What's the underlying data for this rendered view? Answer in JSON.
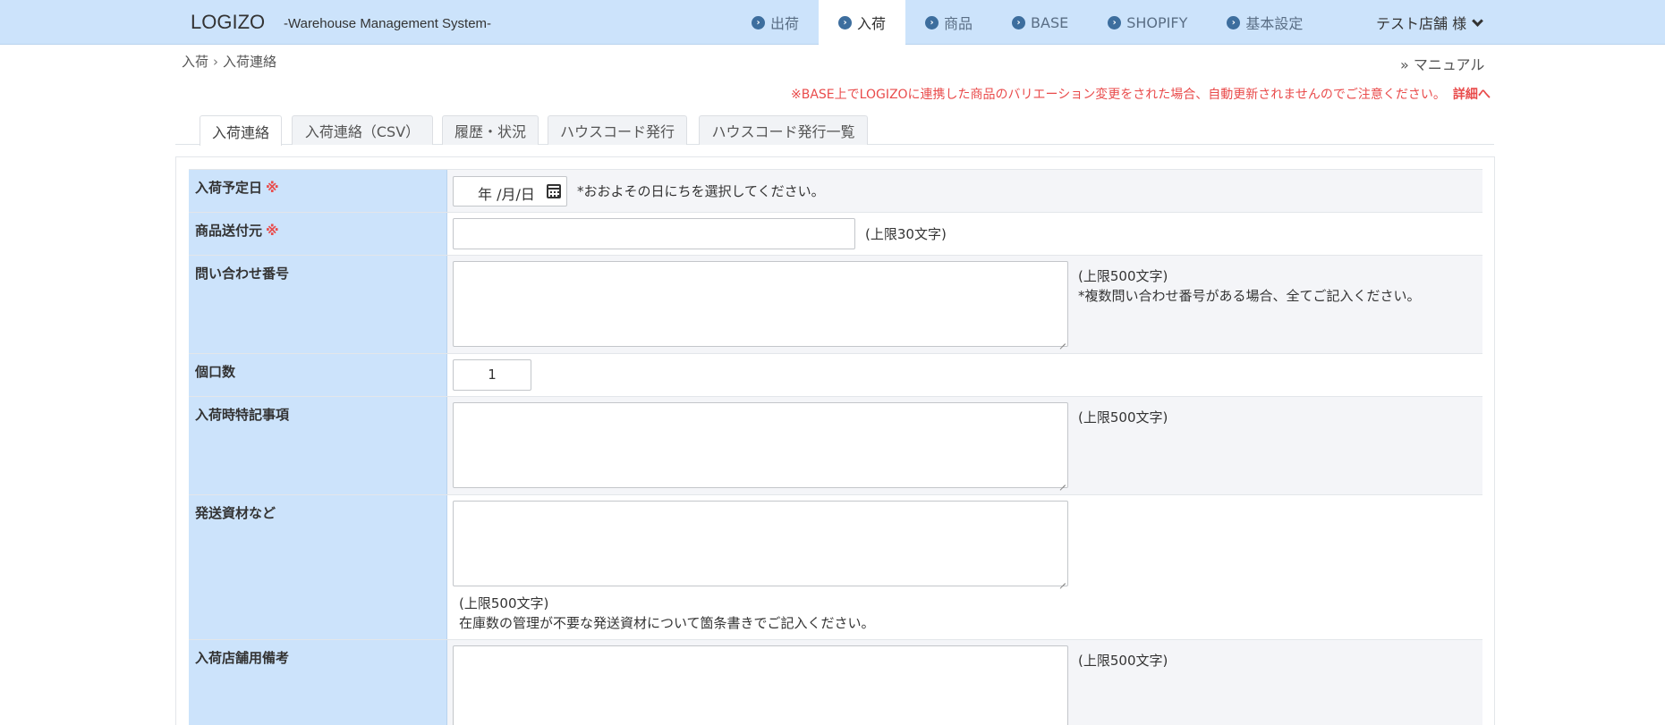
{
  "header": {
    "logo": "LOGIZO",
    "subtitle": "-Warehouse Management System-",
    "nav": [
      {
        "label": "出荷",
        "active": false
      },
      {
        "label": "入荷",
        "active": true
      },
      {
        "label": "商品",
        "active": false
      },
      {
        "label": "BASE",
        "active": false
      },
      {
        "label": "SHOPIFY",
        "active": false
      },
      {
        "label": "基本設定",
        "active": false
      }
    ],
    "user": "テスト店舗 様"
  },
  "breadcrumb": [
    "入荷",
    "入荷連絡"
  ],
  "manual_link": "» マニュアル",
  "notice": {
    "text": "※BASE上でLOGIZOに連携した商品のバリエーション変更をされた場合、自動更新されませんのでご注意ください。",
    "detail": "詳細へ"
  },
  "tabs": [
    "入荷連絡",
    "入荷連絡（CSV）",
    "履歴・状況",
    "ハウスコード発行",
    "ハウスコード発行一覧"
  ],
  "form": {
    "arrival_date": {
      "label": "入荷予定日",
      "required_mark": "※",
      "placeholder": "年 /月/日",
      "hint": "*おおよその日にちを選択してください。"
    },
    "sender": {
      "label": "商品送付元",
      "required_mark": "※",
      "value": "",
      "hint": "(上限30文字)"
    },
    "tracking": {
      "label": "問い合わせ番号",
      "value": "",
      "hint1": "(上限500文字)",
      "hint2": "*複数問い合わせ番号がある場合、全てご記入ください。"
    },
    "pieces": {
      "label": "個口数",
      "value": "1"
    },
    "arrival_notes": {
      "label": "入荷時特記事項",
      "value": "",
      "hint": "(上限500文字)"
    },
    "shipping_materials": {
      "label": "発送資材など",
      "value": "",
      "hint1": "(上限500文字)",
      "hint2": "在庫数の管理が不要な発送資材について箇条書きでご記入ください。"
    },
    "store_notes": {
      "label": "入荷店舗用備考",
      "value": "",
      "hint": "(上限500文字)"
    }
  }
}
